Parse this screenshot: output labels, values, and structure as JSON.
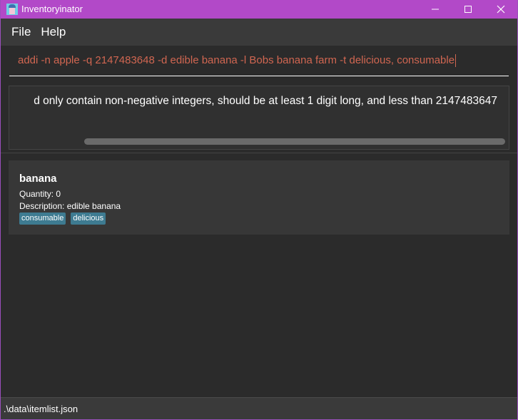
{
  "window": {
    "title": "Inventoryinator"
  },
  "menu": {
    "file_label": "File",
    "help_label": "Help"
  },
  "command": {
    "value": "addi -n apple -q 2147483648 -d edible banana -l Bobs banana farm -t delicious, consumable"
  },
  "result": {
    "message": "d only contain non-negative integers, should be at least 1 digit long, and less than 2147483647"
  },
  "items": [
    {
      "name": "banana",
      "quantity": "Quantity: 0",
      "description": "Description: edible banana",
      "tags": [
        "consumable",
        "delicious"
      ]
    }
  ],
  "status": {
    "file_path": ".\\data\\itemlist.json"
  },
  "colors": {
    "titlebar": "#b249c8",
    "command_text": "#d06651",
    "tag_bg": "#3e7b91"
  }
}
